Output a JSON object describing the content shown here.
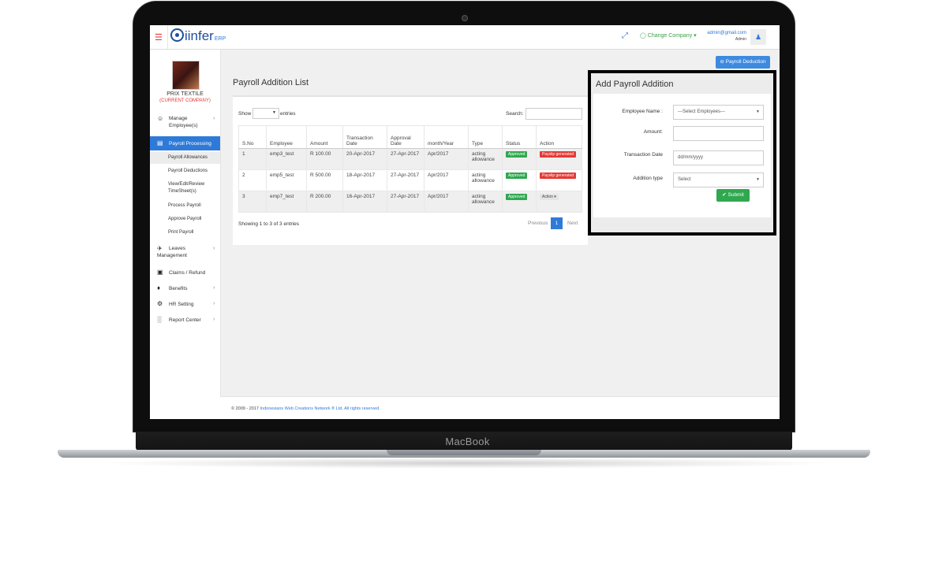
{
  "device": {
    "brand_label": "MacBook"
  },
  "topbar": {
    "logo_text": "iinfer",
    "logo_suffix": "ERP",
    "change_company": "Change Company",
    "user_email": "admin@gmail.com",
    "user_role": "Admin"
  },
  "sidebar": {
    "company_name": "PRIX TEXTILE",
    "company_status": "(CURRENT COMPANY)",
    "items": [
      {
        "label": "Manage Employee(s)",
        "icon": "user-icon"
      },
      {
        "label": "Payroll Processing",
        "icon": "card-icon"
      },
      {
        "label": "Leaves Management",
        "icon": "plane-icon"
      },
      {
        "label": "Claims / Refund",
        "icon": "money-icon"
      },
      {
        "label": "Benefits",
        "icon": "gift-icon"
      },
      {
        "label": "HR Setting",
        "icon": "gear-icon"
      },
      {
        "label": "Report Center",
        "icon": "bar-chart-icon"
      }
    ],
    "payroll_sub": [
      "Payroll Allowances",
      "Payroll Deductions",
      "View/Edit/Review TimeSheet(s)",
      "Process Payroll",
      "Approve Payroll",
      "Print Payroll"
    ]
  },
  "main": {
    "title": "Payroll Addition List",
    "deduction_button": "Payroll Deduction",
    "show_label": "Show",
    "entries_label": "entries",
    "search_label": "Search:",
    "columns": [
      "S.No",
      "Employee",
      "Amount",
      "Transaction Date",
      "Approval Date",
      "month/Year",
      "Type",
      "Status",
      "Action"
    ],
    "rows": [
      {
        "sno": "1",
        "employee": "emp3_test",
        "amount": "R 100.00",
        "transaction_date": "20-Apr-2017",
        "approval_date": "27-Apr-2017",
        "month_year": "Apr/2017",
        "type": "acting allowance",
        "status": "Approved",
        "action": "Payslip generated"
      },
      {
        "sno": "2",
        "employee": "emp5_test",
        "amount": "R 500.00",
        "transaction_date": "18-Apr-2017",
        "approval_date": "27-Apr-2017",
        "month_year": "Apr/2017",
        "type": "acting allowance",
        "status": "Approved",
        "action": "Payslip generated"
      },
      {
        "sno": "3",
        "employee": "emp7_test",
        "amount": "R 200.00",
        "transaction_date": "16-Apr-2017",
        "approval_date": "27-Apr-2017",
        "month_year": "Apr/2017",
        "type": "acting allowance",
        "status": "Approved",
        "action": "Action"
      }
    ],
    "showing": "Showing 1 to 3 of 3 entries",
    "pagination": {
      "previous": "Previous",
      "page": "1",
      "next": "Next"
    }
  },
  "form": {
    "title": "Add Payroll Addition",
    "employee_label": "Employee Name :",
    "employee_value": "---Select Employees---",
    "amount_label": "Amount:",
    "amount_value": "",
    "date_label": "Transaction Date",
    "date_placeholder": "dd/mm/yyyy",
    "type_label": "Addition type",
    "type_value": "Select",
    "submit": "Submit"
  },
  "footer": {
    "prefix": "© 2009 - 2017",
    "link": "Indonesians Web Creations Network ® Ltd. All rights reserved."
  },
  "colors": {
    "primary": "#2f7ad8",
    "success": "#2fa84f",
    "danger": "#e53935"
  }
}
